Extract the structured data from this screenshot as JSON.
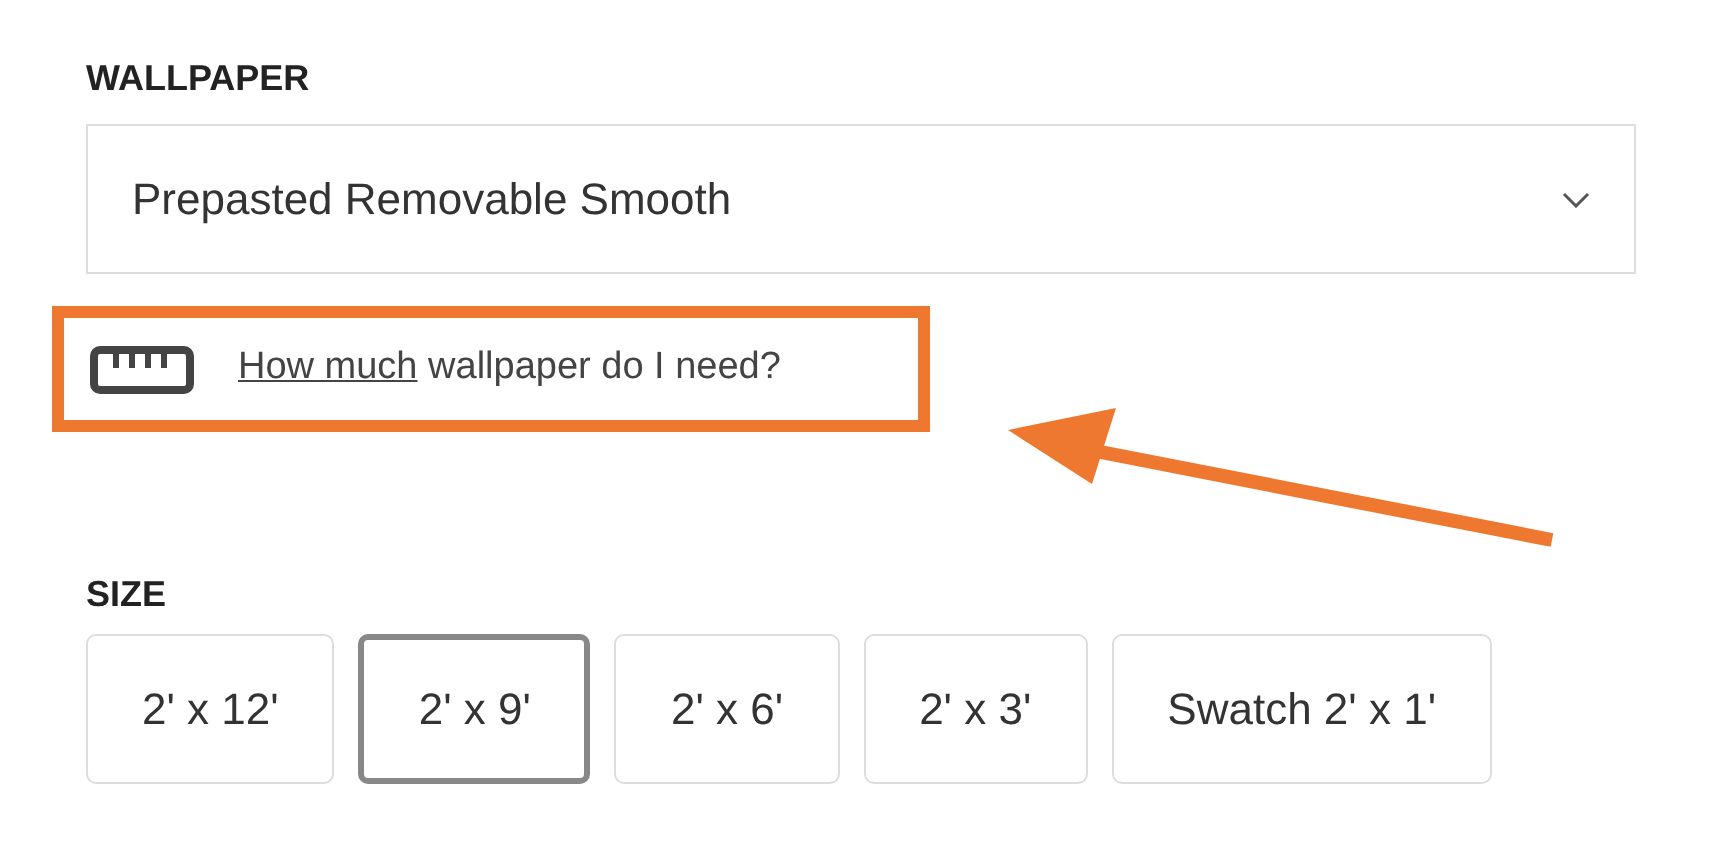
{
  "wallpaper": {
    "label": "WALLPAPER",
    "value": "Prepasted Removable Smooth"
  },
  "guide": {
    "link": "How much",
    "rest": " wallpaper do I need?"
  },
  "size": {
    "label": "SIZE",
    "options": [
      {
        "label": "2' x 12'",
        "selected": false
      },
      {
        "label": "2' x 9'",
        "selected": true
      },
      {
        "label": "2' x 6'",
        "selected": false
      },
      {
        "label": "2' x 3'",
        "selected": false
      },
      {
        "label": "Swatch 2' x 1'",
        "selected": false
      }
    ]
  }
}
